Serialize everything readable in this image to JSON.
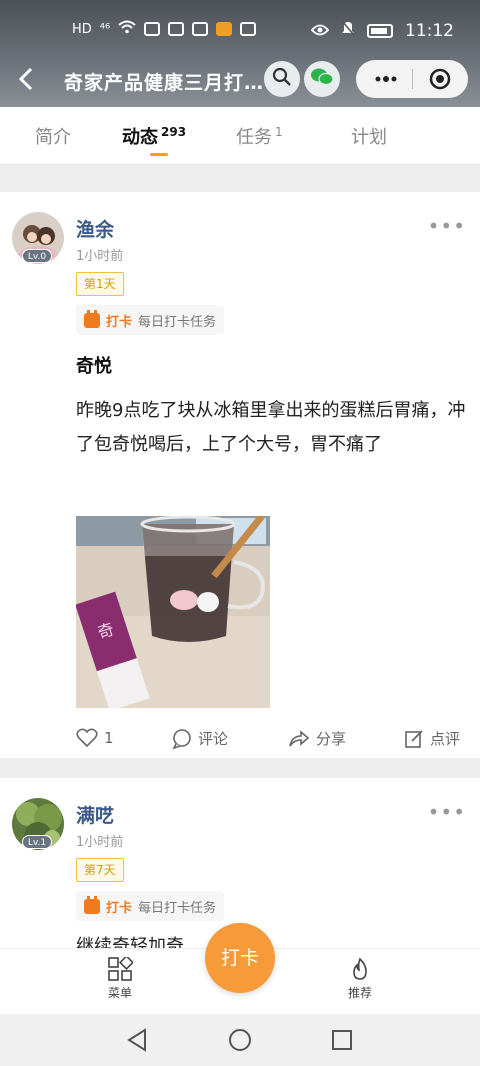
{
  "status": {
    "left_items": [
      "HD",
      "⁴⁶"
    ],
    "time": "11:12"
  },
  "header": {
    "title": "奇家产品健康三月打…"
  },
  "tabs": [
    {
      "label": "简介",
      "count": ""
    },
    {
      "label": "动态",
      "count": "293"
    },
    {
      "label": "任务",
      "count": "1"
    },
    {
      "label": "计划",
      "count": ""
    }
  ],
  "posts": [
    {
      "user": "渔余",
      "level": "Lv.0",
      "time": "1小时前",
      "day": "第1天",
      "task_tag": "打卡",
      "task_name": "每日打卡任务",
      "title": "奇悦",
      "body": "昨晚9点吃了块从冰箱里拿出来的蛋糕后胃痛，冲了包奇悦喝后，上了个大号，胃不痛了",
      "likes": "1",
      "comment": "评论",
      "share": "分享",
      "review": "点评"
    },
    {
      "user": "满呓",
      "level": "Lv.1",
      "time": "1小时前",
      "day": "第7天",
      "task_tag": "打卡",
      "task_name": "每日打卡任务",
      "body": "继续奇轻加奇"
    }
  ],
  "bottom_nav": {
    "menu": "菜单",
    "checkin": "打卡",
    "recommend": "推荐"
  }
}
